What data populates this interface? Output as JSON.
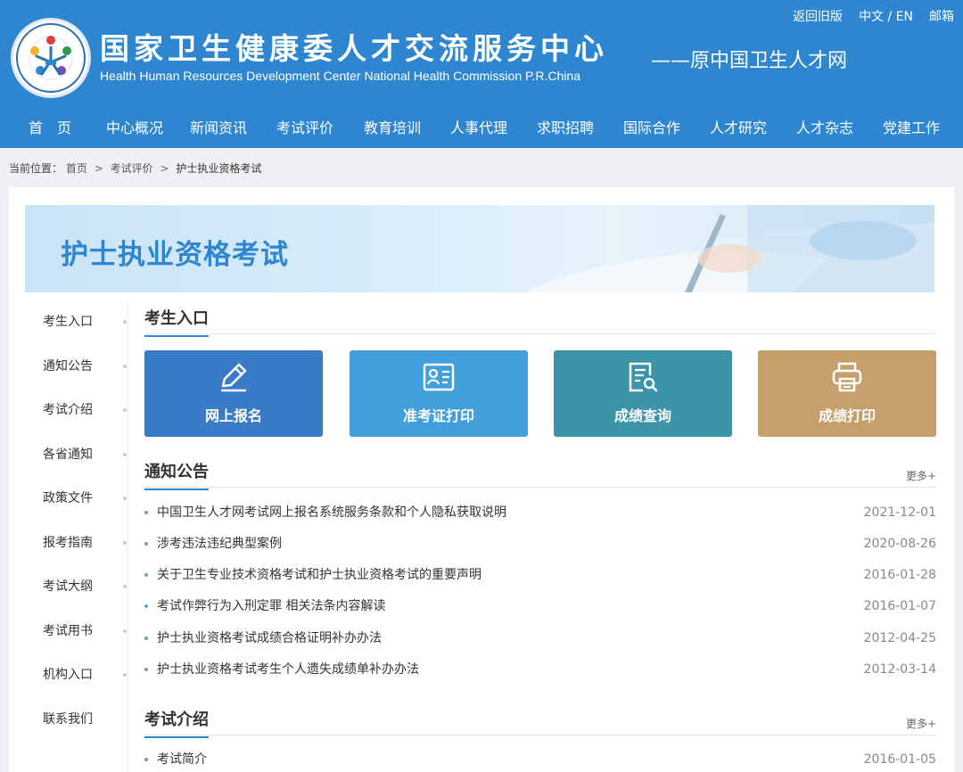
{
  "header": {
    "title_cn": "国家卫生健康委人才交流服务中心",
    "title_en": "Health Human Resources Development Center National Health Commission P.R.China",
    "slogan": "——原中国卫生人才网",
    "toplinks": [
      "返回旧版",
      "中文 / EN",
      "邮箱"
    ]
  },
  "nav": [
    "首　页",
    "中心概况",
    "新闻资讯",
    "考试评价",
    "教育培训",
    "人事代理",
    "求职招聘",
    "国际合作",
    "人才研究",
    "人才杂志",
    "党建工作"
  ],
  "breadcrumb": {
    "prefix": "当前位置：",
    "items": [
      "首页",
      "考试评价"
    ],
    "current": "护士执业资格考试",
    "sep": ">"
  },
  "banner": {
    "title": "护士执业资格考试"
  },
  "sidebar": [
    "考生入口",
    "通知公告",
    "考试介绍",
    "各省通知",
    "政策文件",
    "报考指南",
    "考试大纲",
    "考试用书",
    "机构入口",
    "联系我们"
  ],
  "sections": {
    "entry": {
      "title": "考生入口"
    },
    "notices": {
      "title": "通知公告",
      "more": "更多+"
    },
    "intro": {
      "title": "考试介绍",
      "more": "更多+"
    }
  },
  "tiles": [
    {
      "label": "网上报名",
      "icon": "pencil-icon",
      "color": "#3a7bc8"
    },
    {
      "label": "准考证打印",
      "icon": "id-card-icon",
      "color": "#419fdb"
    },
    {
      "label": "成绩查询",
      "icon": "document-search-icon",
      "color": "#3b94a8"
    },
    {
      "label": "成绩打印",
      "icon": "printer-icon",
      "color": "#c6a06a"
    }
  ],
  "notices": [
    {
      "title": "中国卫生人才网考试网上报名系统服务条款和个人隐私获取说明",
      "date": "2021-12-01"
    },
    {
      "title": "涉考违法违纪典型案例",
      "date": "2020-08-26"
    },
    {
      "title": "关于卫生专业技术资格考试和护士执业资格考试的重要声明",
      "date": "2016-01-28"
    },
    {
      "title": "考试作弊行为入刑定罪 相关法条内容解读",
      "date": "2016-01-07"
    },
    {
      "title": "护士执业资格考试成绩合格证明补办办法",
      "date": "2012-04-25"
    },
    {
      "title": "护士执业资格考试考生个人遗失成绩单补办办法",
      "date": "2012-03-14"
    }
  ],
  "intro_items": [
    {
      "title": "考试简介",
      "date": "2016-01-05"
    }
  ],
  "colors": {
    "brand_blue": "#2d86cf",
    "page_bg": "#eef0f3"
  }
}
